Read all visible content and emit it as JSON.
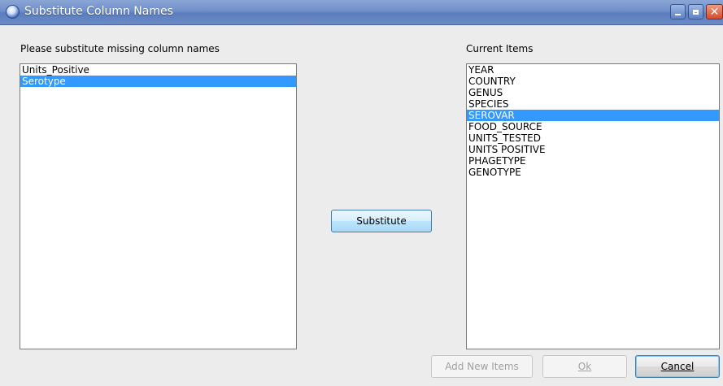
{
  "window": {
    "title": "Substitute Column Names"
  },
  "left_panel": {
    "label": "Please substitute missing column names",
    "items": [
      {
        "label": "Units_Positive",
        "selected": false
      },
      {
        "label": "Serotype",
        "selected": true
      }
    ]
  },
  "right_panel": {
    "label": "Current Items",
    "items": [
      {
        "label": "YEAR",
        "selected": false
      },
      {
        "label": "COUNTRY",
        "selected": false
      },
      {
        "label": "GENUS",
        "selected": false
      },
      {
        "label": "SPECIES",
        "selected": false
      },
      {
        "label": "SEROVAR",
        "selected": true
      },
      {
        "label": "FOOD_SOURCE",
        "selected": false
      },
      {
        "label": "UNITS_TESTED",
        "selected": false
      },
      {
        "label": "UNITS POSITIVE",
        "selected": false
      },
      {
        "label": "PHAGETYPE",
        "selected": false
      },
      {
        "label": "GENOTYPE",
        "selected": false
      }
    ]
  },
  "buttons": {
    "substitute": "Substitute",
    "add_new_items": "Add New Items",
    "ok": "Ok",
    "cancel": "Cancel"
  },
  "colors": {
    "selection": "#3399ff",
    "titlebar": "#6f8fc9"
  }
}
